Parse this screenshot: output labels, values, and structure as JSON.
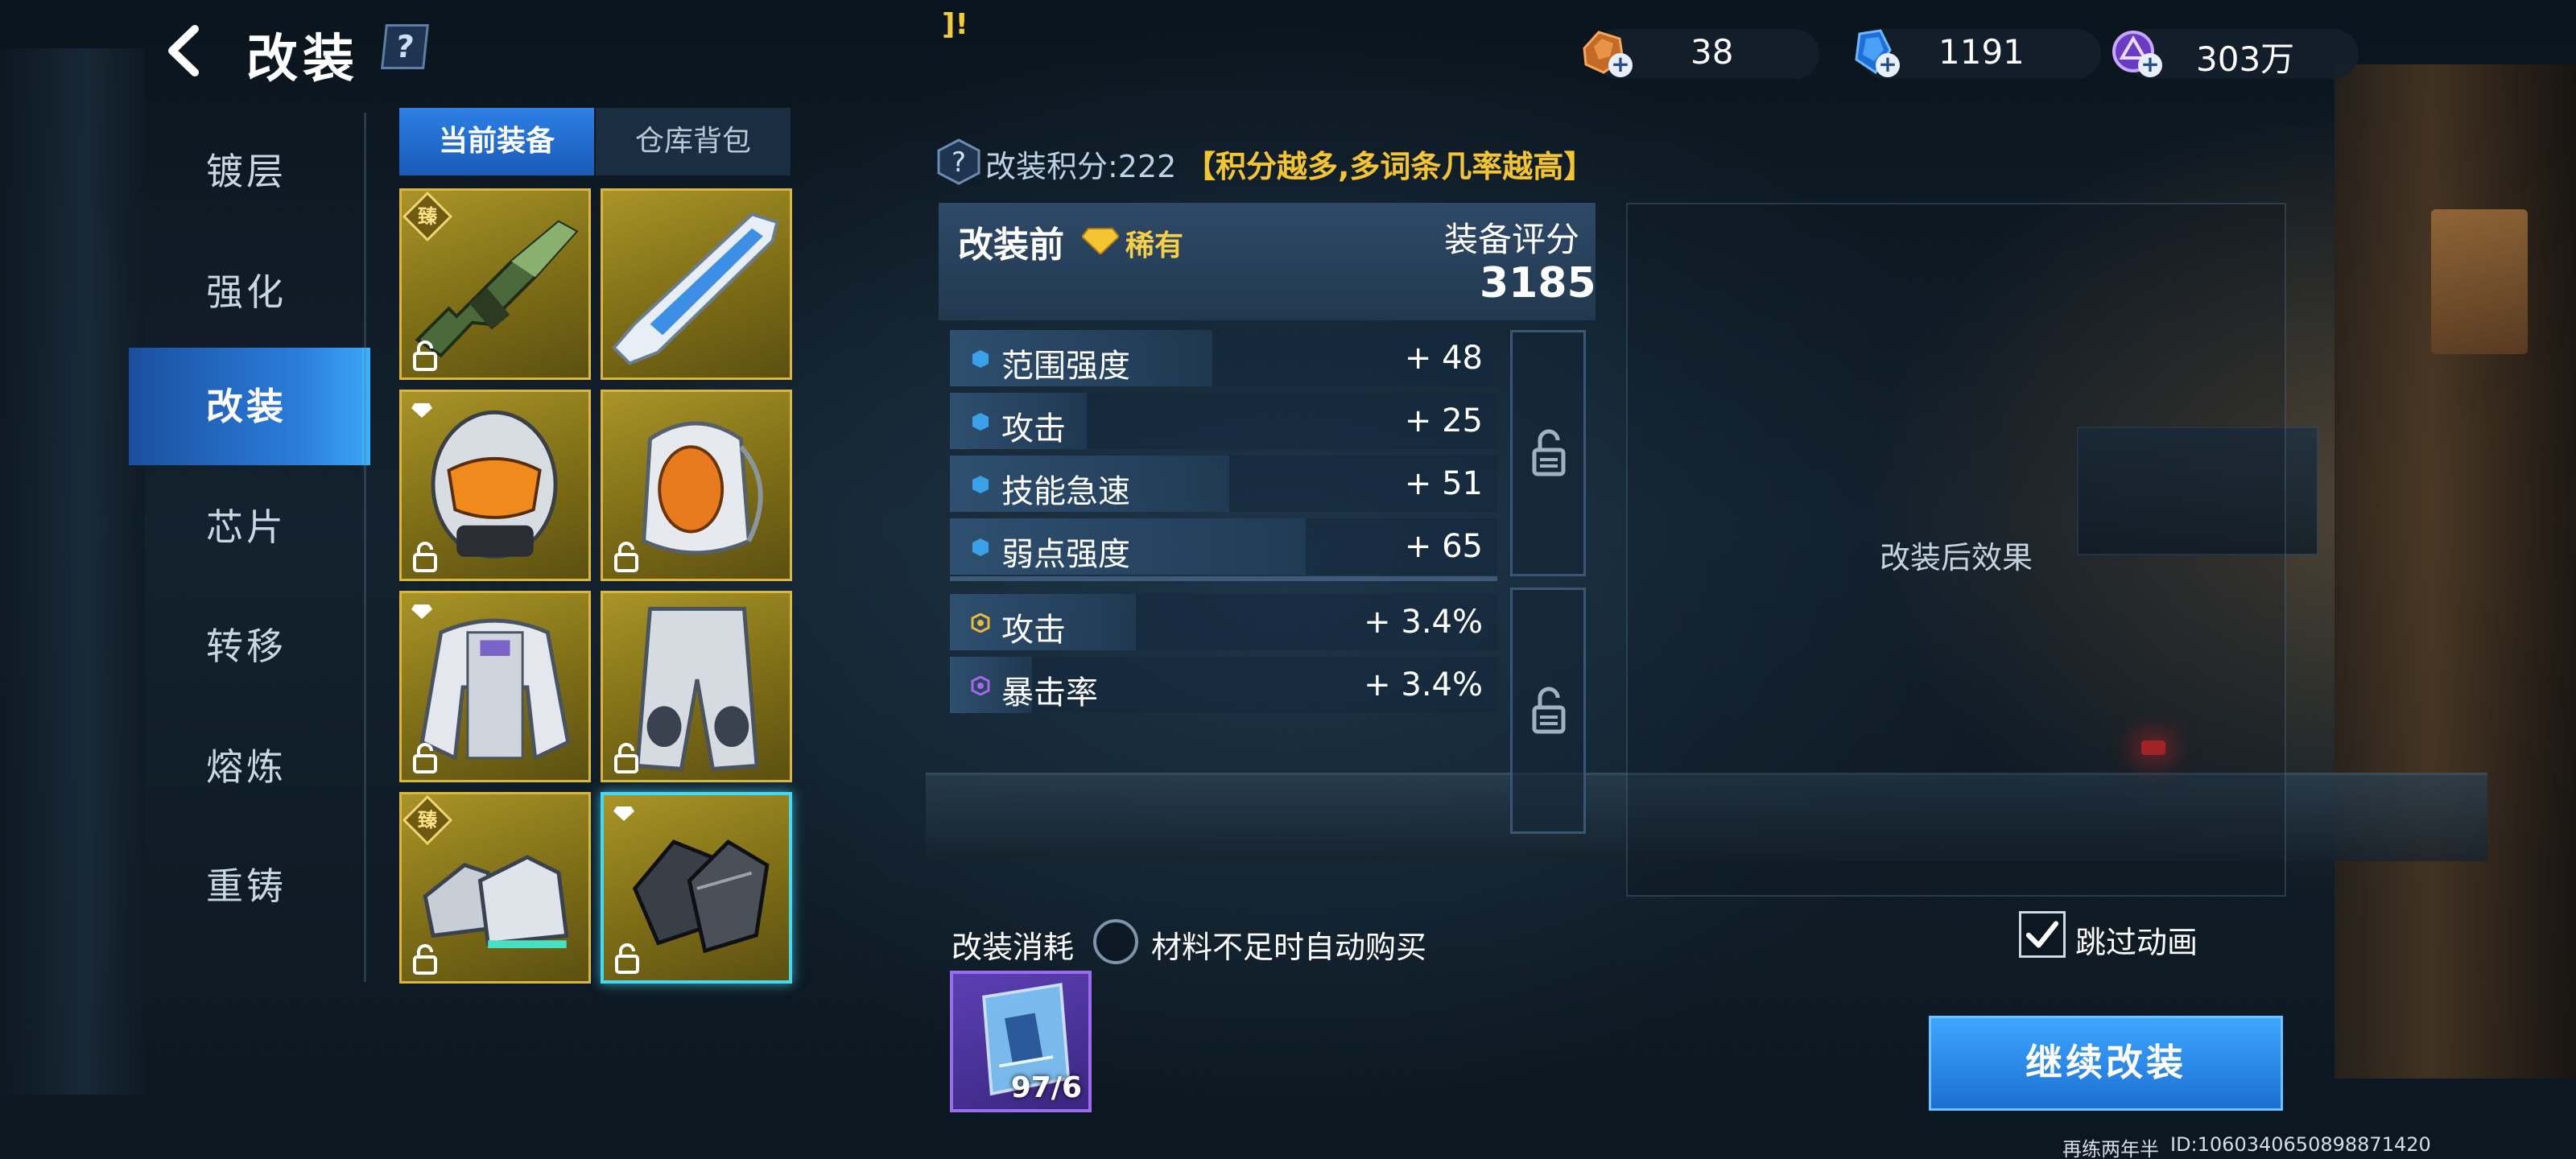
{
  "header": {
    "title": "改装",
    "help": "?",
    "top_note": "]!"
  },
  "currencies": [
    {
      "icon": "ore-crystal-icon",
      "value": "38"
    },
    {
      "icon": "blue-gem-icon",
      "value": "1191"
    },
    {
      "icon": "purple-coin-icon",
      "value": "303万"
    }
  ],
  "sidebar": {
    "items": [
      {
        "label": "镀层"
      },
      {
        "label": "强化"
      },
      {
        "label": "改装"
      },
      {
        "label": "芯片"
      },
      {
        "label": "转移"
      },
      {
        "label": "熔炼"
      },
      {
        "label": "重铸"
      }
    ],
    "active_index": 2
  },
  "tabs": {
    "current": "当前装备",
    "storage": "仓库背包"
  },
  "equipment": [
    {
      "name": "rifle",
      "badge": "臻"
    },
    {
      "name": "cannon",
      "badge": ""
    },
    {
      "name": "helmet",
      "badge": "diamond"
    },
    {
      "name": "backpack",
      "badge": ""
    },
    {
      "name": "jacket",
      "badge": "diamond"
    },
    {
      "name": "pants",
      "badge": ""
    },
    {
      "name": "boots",
      "badge": "臻"
    },
    {
      "name": "gloves",
      "badge": "diamond",
      "selected": true
    }
  ],
  "score": {
    "label": "改装积分:222",
    "hint": "【积分越多,多词条几率越高】"
  },
  "before": {
    "title": "改装前",
    "rarity": "稀有",
    "rating_label": "装备评分",
    "rating": "3185",
    "stats": [
      {
        "name": "范围强度",
        "value": "+ 48",
        "fill": 0.48
      },
      {
        "name": "攻击",
        "value": "+ 25",
        "fill": 0.25
      },
      {
        "name": "技能急速",
        "value": "+ 51",
        "fill": 0.51
      },
      {
        "name": "弱点强度",
        "value": "+ 65",
        "fill": 0.65
      }
    ],
    "bonus_stats": [
      {
        "name": "攻击",
        "value": "+ 3.4%",
        "fill": 0.34,
        "dot": "#e8b93a"
      },
      {
        "name": "暴击率",
        "value": "+ 3.4%",
        "fill": 0.15,
        "dot": "#a768e8"
      }
    ]
  },
  "after": {
    "label": "改装后效果"
  },
  "cost": {
    "label": "改装消耗",
    "auto_buy": "材料不足时自动购买",
    "material_count": "97/6"
  },
  "skip": {
    "label": "跳过动画",
    "checked": true
  },
  "continue_button": "继续改装",
  "footer": {
    "user": "再练两年半",
    "id": "ID:1060340650898871420"
  },
  "colors": {
    "accent": "#2a7bd8",
    "gold": "#f5c431",
    "stat_dot": "#3aa0e8"
  }
}
